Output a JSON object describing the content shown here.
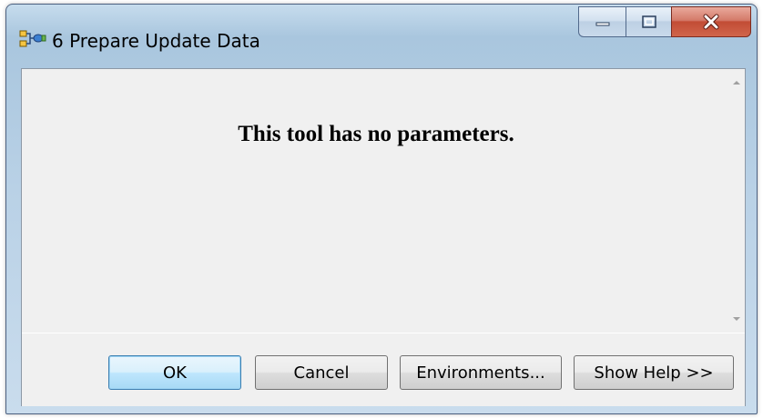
{
  "window": {
    "title": "6 Prepare Update Data",
    "icon": "model-tool-icon",
    "caption_buttons": [
      "minimize",
      "maximize",
      "close"
    ]
  },
  "content": {
    "message": "This tool has no parameters."
  },
  "buttons": {
    "ok": "OK",
    "cancel": "Cancel",
    "environments": "Environments...",
    "show_help": "Show Help >>"
  },
  "colors": {
    "titlebar": "#b9d1e6",
    "close_button": "#c24c35",
    "dialog_background": "#f0f0f0",
    "default_button_border": "#3c7fb1"
  }
}
